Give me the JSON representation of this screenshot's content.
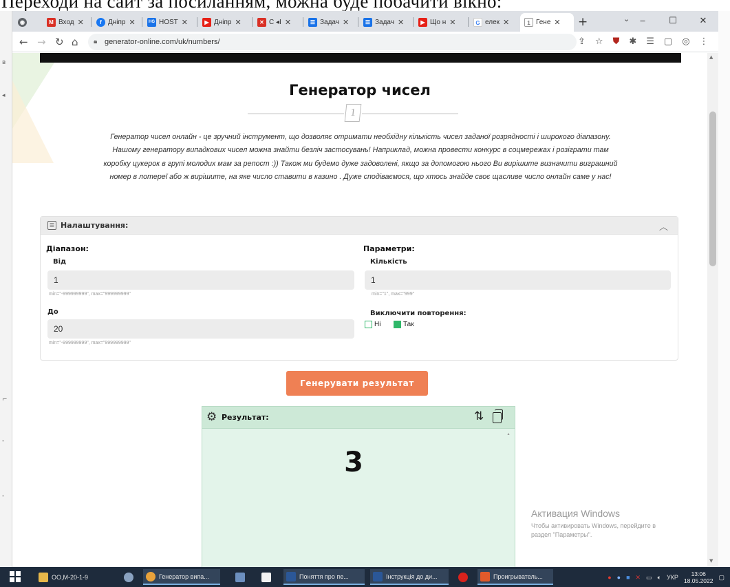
{
  "document": {
    "top_text": "Переходи на сайт за посиланням, можна буде побачити вікно:"
  },
  "browser": {
    "tabs": [
      {
        "label": "",
        "favicon": "chrome-icon",
        "color": "#5f6368"
      },
      {
        "label": "Вход",
        "favicon": "gmail-icon",
        "color": "#d93025"
      },
      {
        "label": "Дніпр",
        "favicon": "facebook-icon",
        "color": "#1877f2"
      },
      {
        "label": "HOST",
        "favicon": "host-icon",
        "color": "#1a73e8"
      },
      {
        "label": "Дніпр",
        "favicon": "youtube-icon",
        "color": "#e62117"
      },
      {
        "label": "C ◂I",
        "favicon": "red-square-icon",
        "color": "#d93025"
      },
      {
        "label": "Задач",
        "favicon": "tasks-icon",
        "color": "#1a73e8"
      },
      {
        "label": "Задач",
        "favicon": "tasks-icon",
        "color": "#1a73e8"
      },
      {
        "label": "Що н",
        "favicon": "youtube-icon",
        "color": "#e62117"
      },
      {
        "label": "елек",
        "favicon": "google-icon",
        "color": "#4285f4"
      },
      {
        "label": "Гене",
        "favicon": "generator-icon",
        "color": "#7a7a7a"
      }
    ],
    "new_tab_symbol": "+",
    "url": "generator-online.com/uk/numbers/",
    "window_controls": [
      "‒",
      "☐",
      "✕"
    ]
  },
  "page": {
    "title": "Генератор чисел",
    "divider_badge": "1",
    "intro_lines": [
      "Генератор чисел онлайн - це зручний інструмент, що дозволяє отримати необхідну кількість чисел заданої розрядності і широкого діапазону.",
      "Нашому генератору випадкових чисел можна знайти безліч застосувань! Наприклад, можна провести конкурс в соцмережах і розіграти там",
      "коробку цукерок в групі молодих мам за репост :)) Також ми будемо дуже задоволені, якщо за допомогою нього Ви вирішите визначити виграшний",
      "номер в лотереї або ж вирішите, на яке число ставити в казино . Дуже сподіваємося, що хтось знайде своє щасливе число онлайн саме у нас!"
    ],
    "settings": {
      "title": "Налаштування:",
      "range": {
        "heading": "Діапазон:",
        "from_label": "Від",
        "from_value": "1",
        "from_hint": "min=\"-999999999\", max=\"999999999\"",
        "to_label": "До",
        "to_value": "20",
        "to_hint": "min=\"-999999999\", max=\"999999999\""
      },
      "params": {
        "heading": "Параметри:",
        "count_label": "Кількість",
        "count_value": "1",
        "count_hint": "min=\"1\", max=\"999\"",
        "exclude_label": "Виключити повторення:",
        "option_no": "Ні",
        "option_yes": "Так",
        "selected": "Так"
      }
    },
    "generate_button": "Генерувати результат",
    "result": {
      "title": "Результат:",
      "value": "3"
    },
    "accent_colors": {
      "button": "#ef8054",
      "result_bg": "#e3f4ea",
      "checkbox": "#2fb86a"
    }
  },
  "activation": {
    "title": "Активация Windows",
    "line1": "Чтобы активировать Windows, перейдите в",
    "line2": "раздел \"Параметры\"."
  },
  "taskbar": {
    "items": [
      {
        "label": "ОО,М-20-1-9",
        "icon": "folder-icon",
        "color": "#e8b84a"
      },
      {
        "label": "",
        "icon": "app-icon",
        "color": "#8aa2c0"
      },
      {
        "label": "Генератор випа...",
        "icon": "chrome-icon",
        "color": "#e9a23b"
      },
      {
        "label": "",
        "icon": "calculator-icon",
        "color": "#6c8fbf"
      },
      {
        "label": "",
        "icon": "notepad-icon",
        "color": "#f2f2f2"
      },
      {
        "label": "Поняття про пе...",
        "icon": "word-icon",
        "color": "#2b5797"
      },
      {
        "label": "Інструкція до ди...",
        "icon": "word-icon",
        "color": "#2b5797"
      },
      {
        "label": "",
        "icon": "opera-icon",
        "color": "#d9221c"
      },
      {
        "label": "Проигрыватель...",
        "icon": "media-player-icon",
        "color": "#e05a2b"
      }
    ],
    "language": "УКР",
    "time": "13:06",
    "date": "18.05.2022"
  }
}
